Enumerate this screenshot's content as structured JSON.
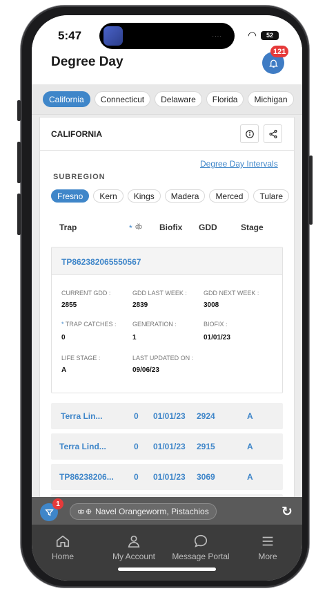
{
  "status": {
    "time": "5:47",
    "battery": "52"
  },
  "header": {
    "title": "Degree Day",
    "notifications": "121"
  },
  "states": [
    "California",
    "Connecticut",
    "Delaware",
    "Florida",
    "Michigan"
  ],
  "card": {
    "title": "CALIFORNIA",
    "intervals_link": "Degree Day Intervals",
    "subregion_label": "SUBREGION",
    "subregions": [
      "Fresno",
      "Kern",
      "Kings",
      "Madera",
      "Merced",
      "Tulare"
    ],
    "columns": {
      "trap": "Trap",
      "catch_star": "*",
      "biofix": "Biofix",
      "gdd": "GDD",
      "stage": "Stage"
    },
    "detail": {
      "trap_id": "TP862382065550567",
      "current_gdd_label": "CURRENT GDD :",
      "current_gdd": "2855",
      "gdd_last_week_label": "GDD LAST WEEK :",
      "gdd_last_week": "2839",
      "gdd_next_week_label": "GDD NEXT WEEK :",
      "gdd_next_week": "3008",
      "trap_catches_star": "*",
      "trap_catches_label": "TRAP CATCHES :",
      "trap_catches": "0",
      "generation_label": "GENERATION :",
      "generation": "1",
      "biofix_label": "BIOFIX :",
      "biofix": "01/01/23",
      "life_stage_label": "LIFE STAGE :",
      "life_stage": "A",
      "last_updated_label": "LAST UPDATED ON :",
      "last_updated": "09/06/23"
    },
    "rows": [
      {
        "trap": "Terra Lin...",
        "catches": "0",
        "biofix": "01/01/23",
        "gdd": "2924",
        "stage": "A"
      },
      {
        "trap": "Terra Lind...",
        "catches": "0",
        "biofix": "01/01/23",
        "gdd": "2915",
        "stage": "A"
      },
      {
        "trap": "TP86238206...",
        "catches": "0",
        "biofix": "01/01/23",
        "gdd": "3069",
        "stage": "A"
      }
    ]
  },
  "filter": {
    "count": "1",
    "pill": "Navel Orangeworm, Pistachios"
  },
  "nav": {
    "home": "Home",
    "account": "My Account",
    "messages": "Message Portal",
    "more": "More"
  },
  "colors": {
    "accent": "#3f86c9",
    "badge": "#e63a3a",
    "nav_bg": "#3c3c3c"
  }
}
